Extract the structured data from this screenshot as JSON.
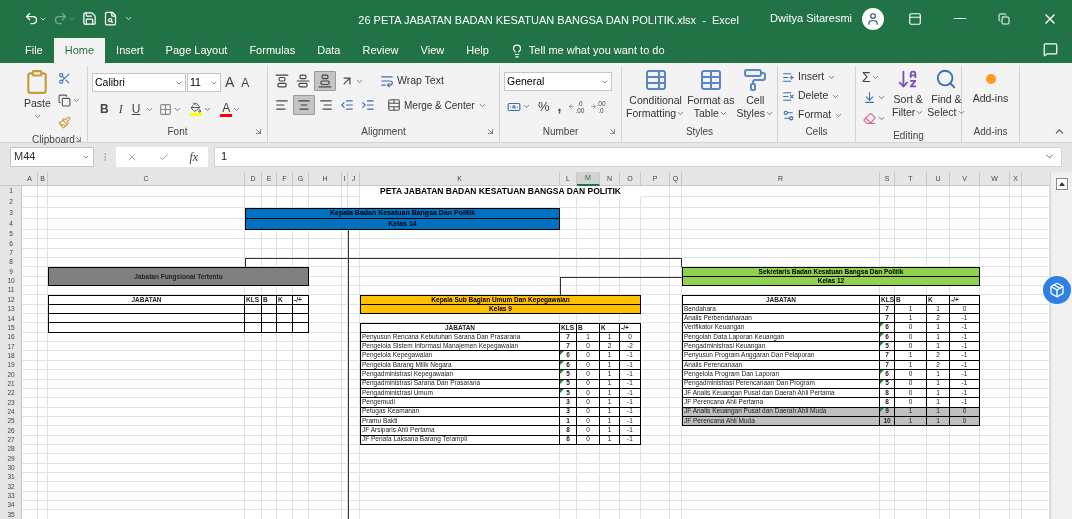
{
  "window": {
    "title": "26 PETA JABATAN BADAN KESATUAN BANGSA DAN POLITIK.xlsx  -  Excel",
    "user": "Dwitya Sitaresmi"
  },
  "quick_access": {
    "redo": {
      "disabled": true
    }
  },
  "tabs": [
    {
      "label": "File",
      "selected": false
    },
    {
      "label": "Home",
      "selected": true
    },
    {
      "label": "Insert",
      "selected": false
    },
    {
      "label": "Page Layout",
      "selected": false
    },
    {
      "label": "Formulas",
      "selected": false
    },
    {
      "label": "Data",
      "selected": false
    },
    {
      "label": "Review",
      "selected": false
    },
    {
      "label": "View",
      "selected": false
    },
    {
      "label": "Help",
      "selected": false
    }
  ],
  "tell_me": {
    "placeholder": "Tell me what you want to do"
  },
  "ribbon": {
    "clipboard": {
      "label": "Clipboard",
      "paste": "Paste"
    },
    "font": {
      "label": "Font",
      "family": "Calibri",
      "size": "11",
      "grow": "A",
      "shrink": "A",
      "bold": "B",
      "italic": "I",
      "underline": "U",
      "color_letter": "A"
    },
    "alignment": {
      "label": "Alignment",
      "wrap": "Wrap Text",
      "merge": "Merge & Center",
      "vertical": [
        {
          "selected": false
        },
        {
          "selected": false
        },
        {
          "selected": true
        }
      ],
      "horizontal": [
        {
          "selected": false
        },
        {
          "selected": true
        },
        {
          "selected": false
        }
      ]
    },
    "number": {
      "label": "Number",
      "format": "General",
      "percent": "%",
      "comma": ",",
      "increase_decimal": [
        ".0",
        ".00"
      ],
      "decrease_decimal": [
        ".00",
        ".0"
      ]
    },
    "styles": {
      "label": "Styles",
      "buttons": [
        [
          "Conditional",
          "Formatting"
        ],
        [
          "Format as",
          "Table"
        ],
        [
          "Cell",
          "Styles"
        ]
      ]
    },
    "cells": {
      "label": "Cells",
      "buttons": [
        "Insert",
        "Delete",
        "Format"
      ]
    },
    "editing": {
      "label": "Editing",
      "sum": "Σ",
      "sort": [
        "Sort &",
        "Filter"
      ],
      "find": [
        "Find &",
        "Select"
      ]
    },
    "addins": {
      "label": "Add-ins",
      "button": "Add-ins"
    }
  },
  "formula_bar": {
    "name_box": "M44",
    "fx": "fx",
    "value": "1"
  },
  "sheet": {
    "columns": [
      {
        "label": "A",
        "selected": false
      },
      {
        "label": "B",
        "selected": false
      },
      {
        "label": "C",
        "selected": false
      },
      {
        "label": "D",
        "selected": false
      },
      {
        "label": "E",
        "selected": false
      },
      {
        "label": "F",
        "selected": false
      },
      {
        "label": "G",
        "selected": false
      },
      {
        "label": "H",
        "selected": false
      },
      {
        "label": "I",
        "selected": false
      },
      {
        "label": "J",
        "selected": false
      },
      {
        "label": "K",
        "selected": false
      },
      {
        "label": "L",
        "selected": false
      },
      {
        "label": "M",
        "selected": true
      },
      {
        "label": "N",
        "selected": false
      },
      {
        "label": "O",
        "selected": false
      },
      {
        "label": "P",
        "selected": false
      },
      {
        "label": "Q",
        "selected": false
      },
      {
        "label": "R",
        "selected": false
      },
      {
        "label": "S",
        "selected": false
      },
      {
        "label": "T",
        "selected": false
      },
      {
        "label": "U",
        "selected": false
      },
      {
        "label": "V",
        "selected": false
      },
      {
        "label": "W",
        "selected": false
      },
      {
        "label": "X",
        "selected": false
      }
    ],
    "rows": [
      "1",
      "2",
      "3",
      "4",
      "5",
      "6",
      "7",
      "8",
      "9",
      "10",
      "11",
      "12",
      "13",
      "14",
      "15",
      "16",
      "17",
      "18",
      "19",
      "20",
      "21",
      "22",
      "23",
      "24",
      "25",
      "26",
      "27",
      "28",
      "29",
      "30",
      "31",
      "32",
      "33",
      "34",
      "35"
    ],
    "title": "PETA JABATAN BADAN KESATUAN BANGSA DAN POLITIK",
    "head_box": {
      "name": "Kepala Badan Kesatuan Bangsa Dan Politik",
      "grade": "Kelas 14",
      "color": "#0070c0"
    },
    "functional_box": {
      "name": "Jabatan Fungsional Tertentu",
      "color": "#808080",
      "columns": [
        "JABATAN",
        "KLS",
        "B",
        "K",
        "-/+"
      ]
    },
    "units": [
      {
        "name": "Kepala Sub Bagian Umum Dan Kepegawaian",
        "grade": "Kelas 9",
        "color": "#ffc000",
        "columns": [
          "JABATAN",
          "KLS",
          "B",
          "K",
          "-/+"
        ],
        "rows": [
          {
            "cells": [
              "Penyusun Rencana Kebutuhan Sarana Dan Prasarana",
              "7",
              "1",
              "1",
              "0"
            ],
            "flagged": false,
            "highlighted": false
          },
          {
            "cells": [
              "Pengelola Sistem Informasi Manajemen Kepegawaian",
              "7",
              "0",
              "2",
              "-2"
            ],
            "flagged": false,
            "highlighted": false
          },
          {
            "cells": [
              "Pengelola Kepegawaian",
              "6",
              "0",
              "1",
              "-1"
            ],
            "flagged": true,
            "highlighted": false
          },
          {
            "cells": [
              "Pengelola Barang Milik Negara",
              "6",
              "0",
              "1",
              "-1"
            ],
            "flagged": true,
            "highlighted": false
          },
          {
            "cells": [
              "Pengadministrasi Kepegawaian",
              "5",
              "0",
              "1",
              "-1"
            ],
            "flagged": true,
            "highlighted": false
          },
          {
            "cells": [
              "Pengadministrasi Sarana Dan Prasarana",
              "5",
              "0",
              "1",
              "-1"
            ],
            "flagged": true,
            "highlighted": false
          },
          {
            "cells": [
              "Pengadministrasi Umum",
              "5",
              "0",
              "1",
              "-1"
            ],
            "flagged": true,
            "highlighted": false
          },
          {
            "cells": [
              "Pengemudi",
              "3",
              "0",
              "1",
              "-1"
            ],
            "flagged": false,
            "highlighted": false
          },
          {
            "cells": [
              "Petugas Keamanan",
              "3",
              "0",
              "1",
              "-1"
            ],
            "flagged": false,
            "highlighted": false
          },
          {
            "cells": [
              "Pramu Bakti",
              "1",
              "0",
              "1",
              "-1"
            ],
            "flagged": false,
            "highlighted": false
          },
          {
            "cells": [
              "JF Arsiparis Ahli Pertama",
              "8",
              "0",
              "1",
              "-1"
            ],
            "flagged": false,
            "highlighted": false
          },
          {
            "cells": [
              "JF Penata Laksana Barang Terampil",
              "6",
              "0",
              "1",
              "-1"
            ],
            "flagged": false,
            "highlighted": false
          }
        ]
      },
      {
        "name": "Sekretaris Badan Kesatuan Bangsa Dan Politik",
        "grade": "Kelas 12",
        "color": "#92d050",
        "columns": [
          "JABATAN",
          "KLS",
          "B",
          "K",
          "-/+"
        ],
        "rows": [
          {
            "cells": [
              "Bendahara",
              "7",
              "1",
              "1",
              "0"
            ],
            "flagged": false,
            "highlighted": false
          },
          {
            "cells": [
              "Analis Perbendaharaan",
              "7",
              "1",
              "2",
              "-1"
            ],
            "flagged": false,
            "highlighted": false
          },
          {
            "cells": [
              "Verifikator Keuangan",
              "6",
              "0",
              "1",
              "-1"
            ],
            "flagged": true,
            "highlighted": false
          },
          {
            "cells": [
              "Pengolah Data Laporan Keuangan",
              "6",
              "0",
              "1",
              "-1"
            ],
            "flagged": true,
            "highlighted": false
          },
          {
            "cells": [
              "Pengadministrasi Keuangan",
              "5",
              "0",
              "1",
              "-1"
            ],
            "flagged": true,
            "highlighted": false
          },
          {
            "cells": [
              "Penyusun Program Anggaran Dan Pelaporan",
              "7",
              "1",
              "2",
              "-1"
            ],
            "flagged": false,
            "highlighted": false
          },
          {
            "cells": [
              "Analis Perencanaan",
              "7",
              "1",
              "2",
              "-1"
            ],
            "flagged": false,
            "highlighted": false
          },
          {
            "cells": [
              "Pengelola Program Dan Laporan",
              "6",
              "0",
              "1",
              "-1"
            ],
            "flagged": true,
            "highlighted": false
          },
          {
            "cells": [
              "Pengadministrasi Perencanaan Dan Program",
              "5",
              "0",
              "1",
              "-1"
            ],
            "flagged": true,
            "highlighted": false
          },
          {
            "cells": [
              "JF Analis Keuangan Pusat dan Daerah Ahli Pertama",
              "8",
              "0",
              "1",
              "-1"
            ],
            "flagged": false,
            "highlighted": false
          },
          {
            "cells": [
              "JF Perencana Ahli Pertama",
              "8",
              "0",
              "1",
              "-1"
            ],
            "flagged": false,
            "highlighted": false
          },
          {
            "cells": [
              "JF Analis Keuangan Pusat dan Daerah Ahli Muda",
              "9",
              "1",
              "1",
              "0"
            ],
            "flagged": true,
            "highlighted": true
          },
          {
            "cells": [
              "JF Perencana Ahli Muda",
              "10",
              "1",
              "1",
              "0"
            ],
            "flagged": false,
            "highlighted": true
          }
        ]
      }
    ]
  }
}
